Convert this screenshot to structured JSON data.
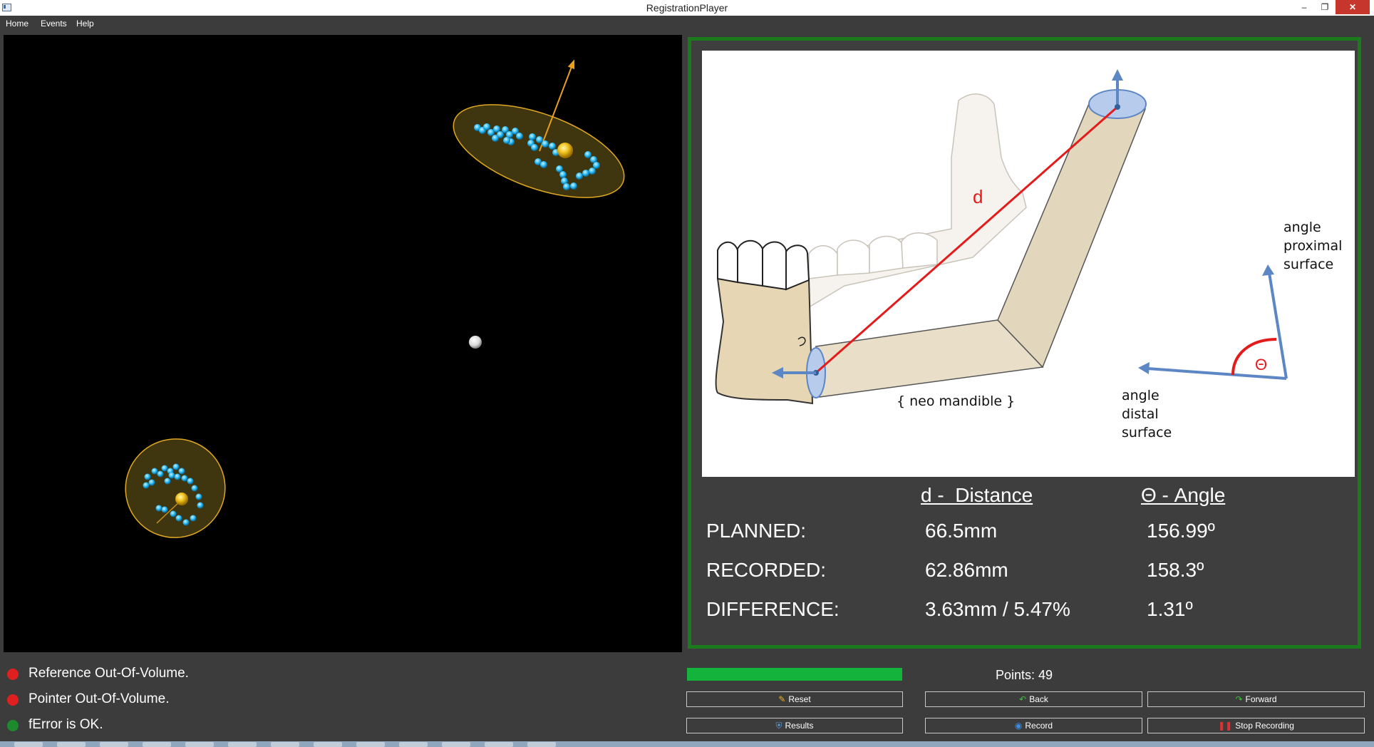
{
  "window": {
    "title": "RegistrationPlayer",
    "minimize_glyph": "–",
    "maximize_glyph": "❐",
    "close_glyph": "✕"
  },
  "menu": {
    "items": [
      "Home",
      "Events",
      "Help"
    ]
  },
  "diagram": {
    "label_d": "d",
    "label_theta": "Θ",
    "label_neo_mandible": "{ neo mandible }",
    "label_proximal": [
      "angle",
      "proximal",
      "surface"
    ],
    "label_distal": [
      "angle",
      "distal",
      "surface"
    ]
  },
  "results": {
    "headers": {
      "distance": "d -  Distance",
      "angle": "Θ - Angle"
    },
    "rows": [
      {
        "label": "PLANNED:",
        "distance": "66.5mm",
        "angle": "156.99º"
      },
      {
        "label": "RECORDED:",
        "distance": "62.86mm",
        "angle": "158.3º"
      },
      {
        "label": "DIFFERENCE:",
        "distance": "3.63mm / 5.47%",
        "angle": "1.31º"
      }
    ]
  },
  "status": [
    {
      "text": "Reference Out-Of-Volume.",
      "color": "#e02020"
    },
    {
      "text": "Pointer Out-Of-Volume.",
      "color": "#e02020"
    },
    {
      "text": "fError is OK.",
      "color": "#1e8a2e"
    }
  ],
  "progress": {
    "fraction": 1.0,
    "color": "#14b33b"
  },
  "points_label": "Points: 49",
  "buttons": {
    "reset": "Reset",
    "back": "Back",
    "forward": "Forward",
    "results": "Results",
    "record": "Record",
    "stop_recording": "Stop Recording"
  },
  "icons": {
    "reset": "broom-icon",
    "back": "back-arrow-icon",
    "forward": "forward-arrow-icon",
    "results": "shield-icon",
    "record": "record-icon",
    "stop_recording": "stop-icon"
  }
}
